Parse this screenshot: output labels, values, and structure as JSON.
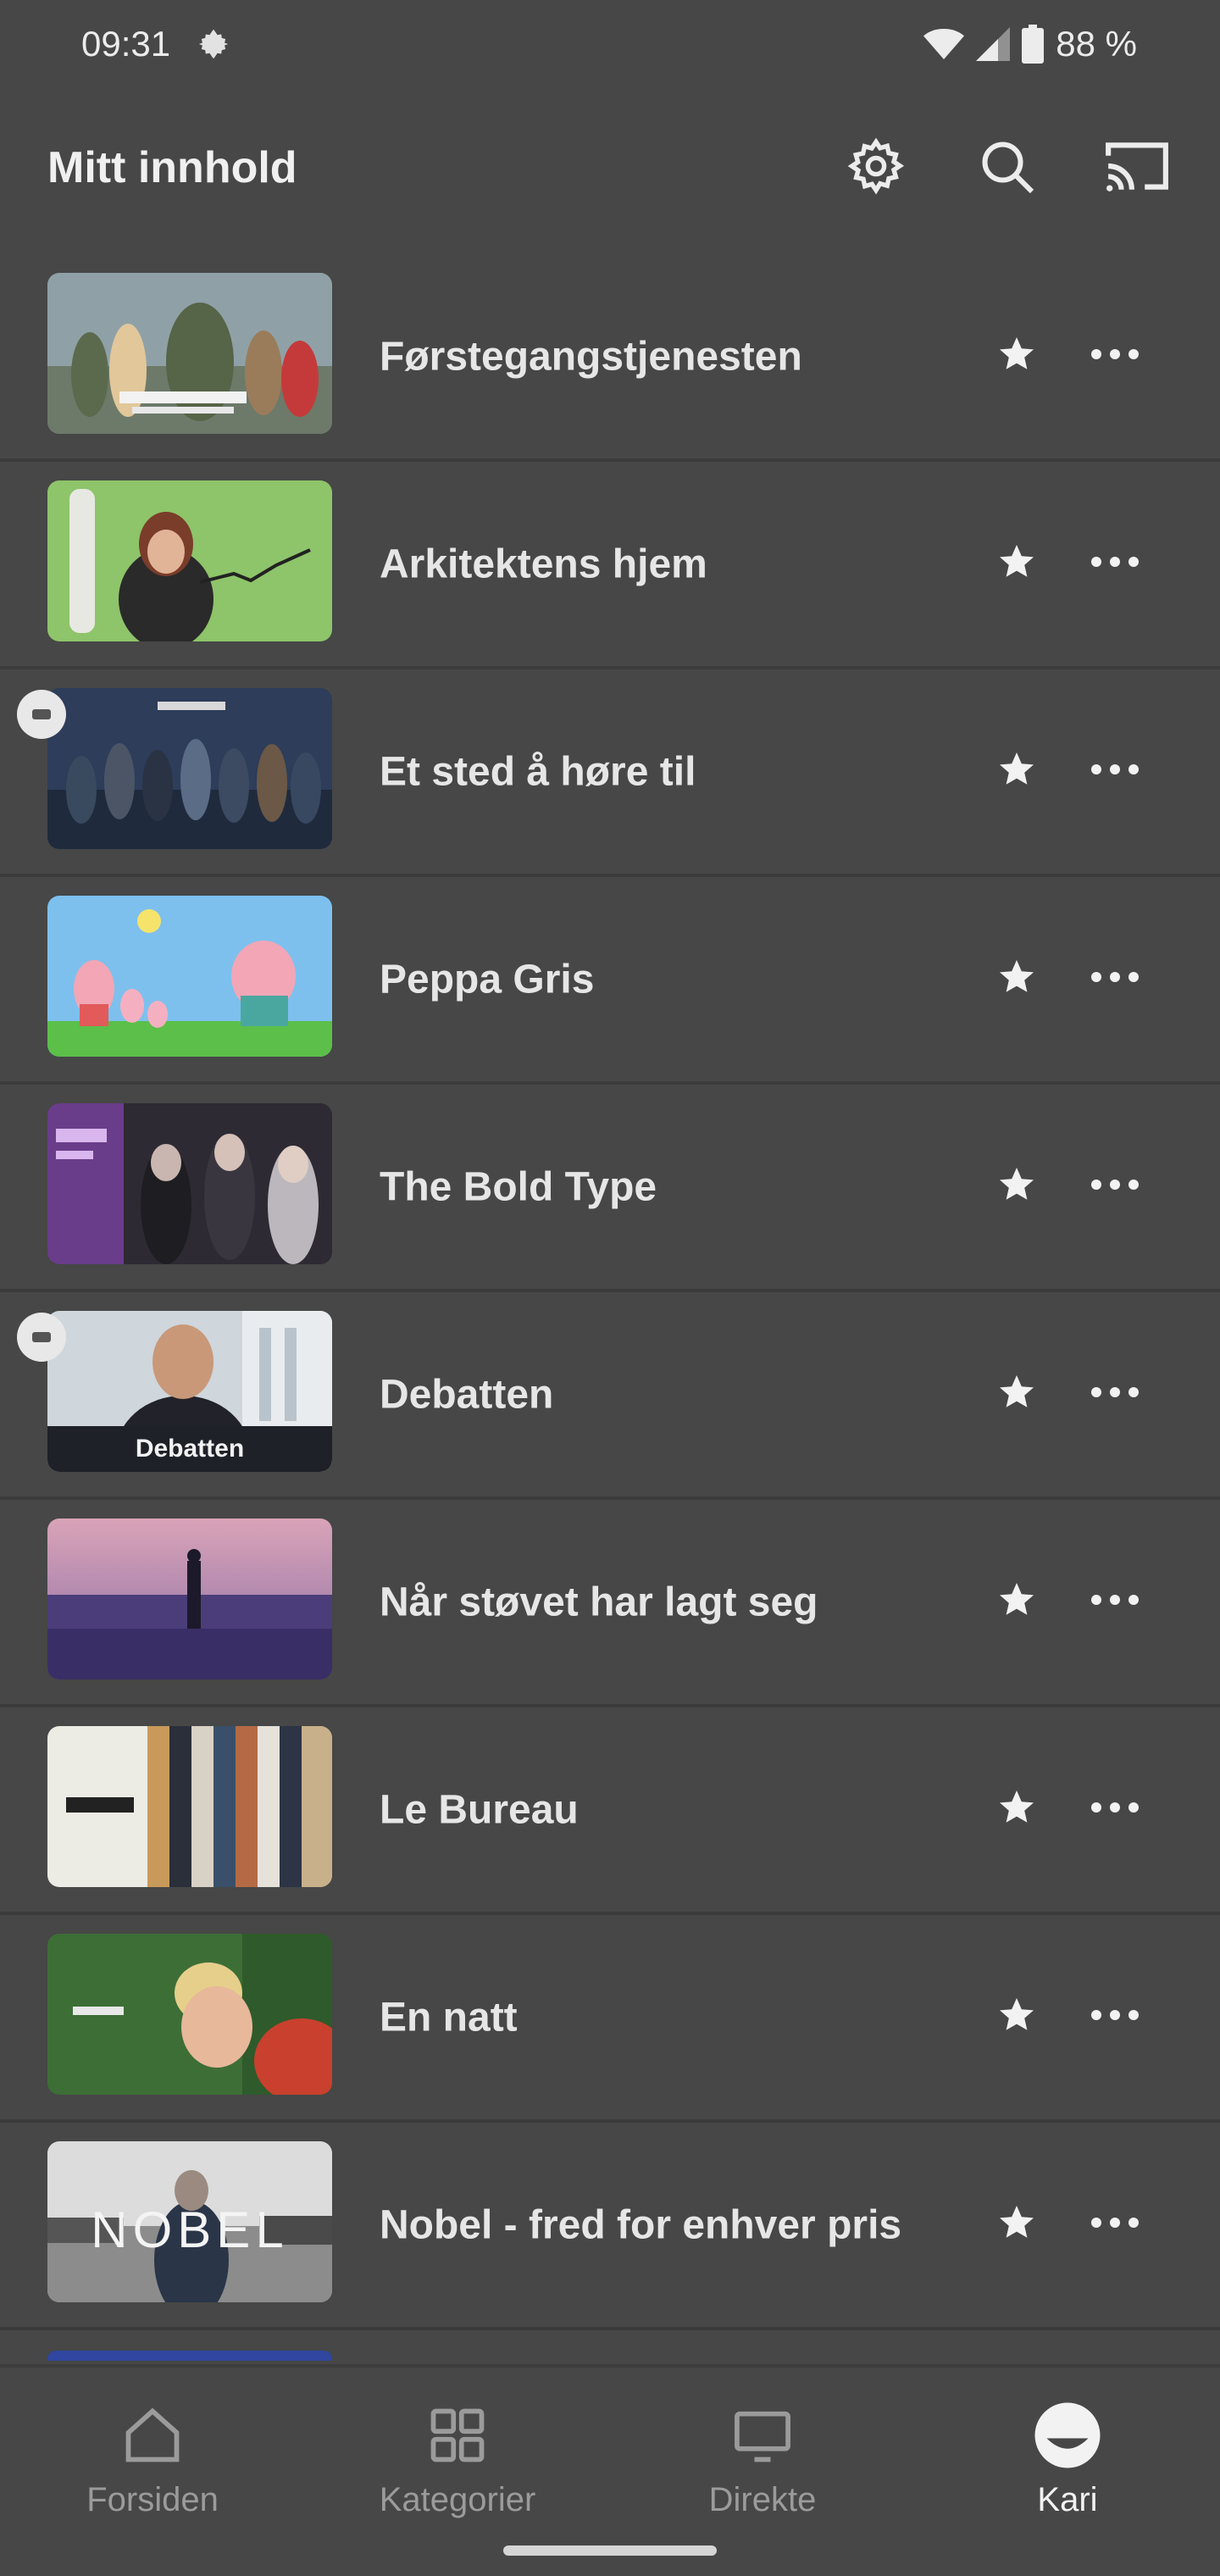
{
  "status_bar": {
    "time": "09:31",
    "battery": "88 %",
    "icons": [
      "settings-gear-icon",
      "wifi-icon",
      "signal-icon",
      "battery-icon"
    ]
  },
  "app_bar": {
    "title": "Mitt innhold",
    "actions": [
      "settings-icon",
      "search-icon",
      "cast-icon"
    ]
  },
  "items": [
    {
      "title": "Førstegangstjenesten",
      "badge": "",
      "thumb": "forstegang"
    },
    {
      "title": "Arkitektens hjem",
      "badge": "",
      "thumb": "arkitekt"
    },
    {
      "title": "Et sted å høre til",
      "badge": "",
      "thumb": "etsted"
    },
    {
      "title": "Peppa Gris",
      "badge": "",
      "thumb": "peppa"
    },
    {
      "title": "The Bold Type",
      "badge": "",
      "thumb": "boldtype"
    },
    {
      "title": "Debatten",
      "badge": "",
      "thumb": "debatten"
    },
    {
      "title": "Når støvet har lagt seg",
      "badge": "",
      "thumb": "stovet"
    },
    {
      "title": "Le Bureau",
      "badge": "",
      "thumb": "bureau"
    },
    {
      "title": "En natt",
      "badge": "",
      "thumb": "ennatt"
    },
    {
      "title": "Nobel - fred for enhver pris",
      "badge": "",
      "thumb": "nobel"
    }
  ],
  "thumb_text": {
    "debatten": "Debatten",
    "nobel": "NOBEL"
  },
  "bottom_nav": [
    {
      "label": "Forsiden",
      "icon": "home-icon",
      "active": false
    },
    {
      "label": "Kategorier",
      "icon": "grid-icon",
      "active": false
    },
    {
      "label": "Direkte",
      "icon": "tv-icon",
      "active": false
    },
    {
      "label": "Kari",
      "icon": "avatar-icon",
      "active": true
    }
  ],
  "colors": {
    "background": "#464746",
    "text": "#e6e6e6",
    "nav_inactive": "#9a9b9a"
  }
}
